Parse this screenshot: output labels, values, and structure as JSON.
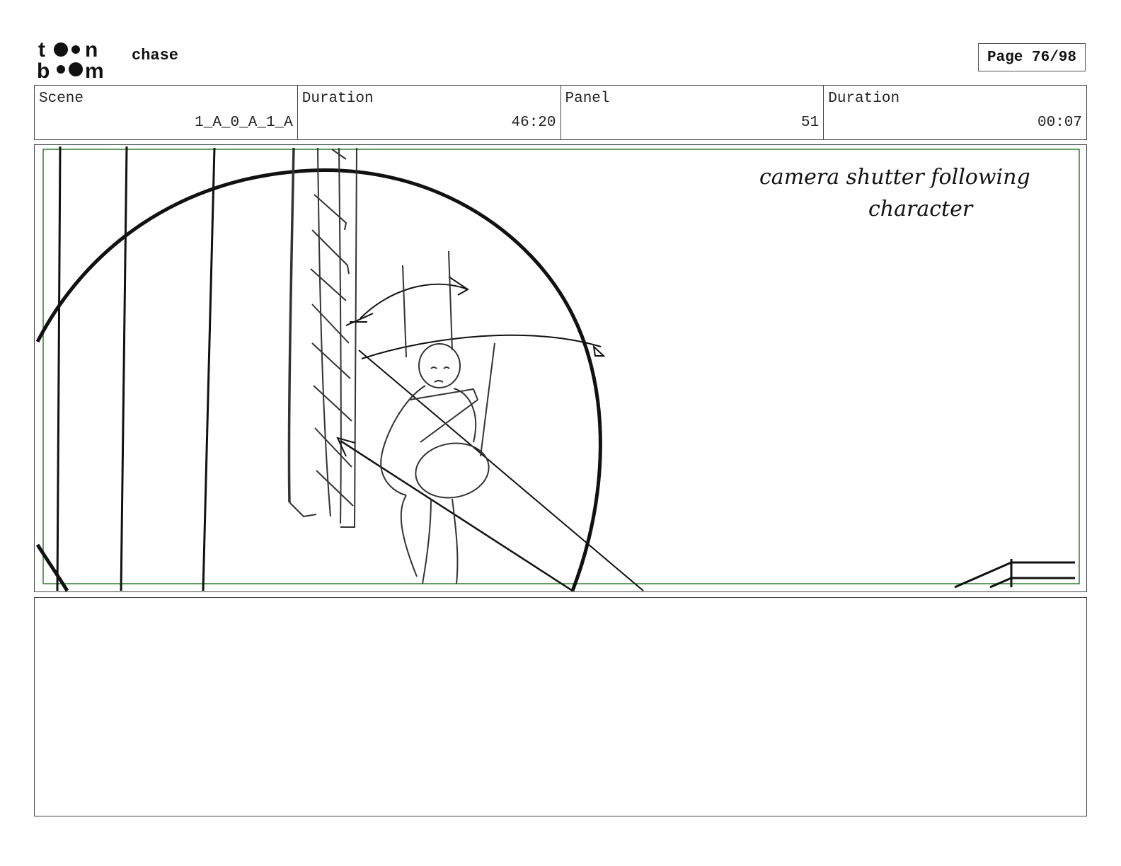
{
  "header": {
    "logo_text": "toon boom",
    "project_title": "chase",
    "page_label": "Page 76/98"
  },
  "info": {
    "scene_label": "Scene",
    "scene_value": "1_A_0_A_1_A",
    "duration_label": "Duration",
    "duration_value": "46:20",
    "panel_label": "Panel",
    "panel_value": "51",
    "panel_duration_label": "Duration",
    "panel_duration_value": "00:07"
  },
  "panel": {
    "annotation_line1": "camera shutter following",
    "annotation_line2": "character",
    "safe_frame_color": "#2e7d32"
  },
  "notes": {
    "text": ""
  }
}
